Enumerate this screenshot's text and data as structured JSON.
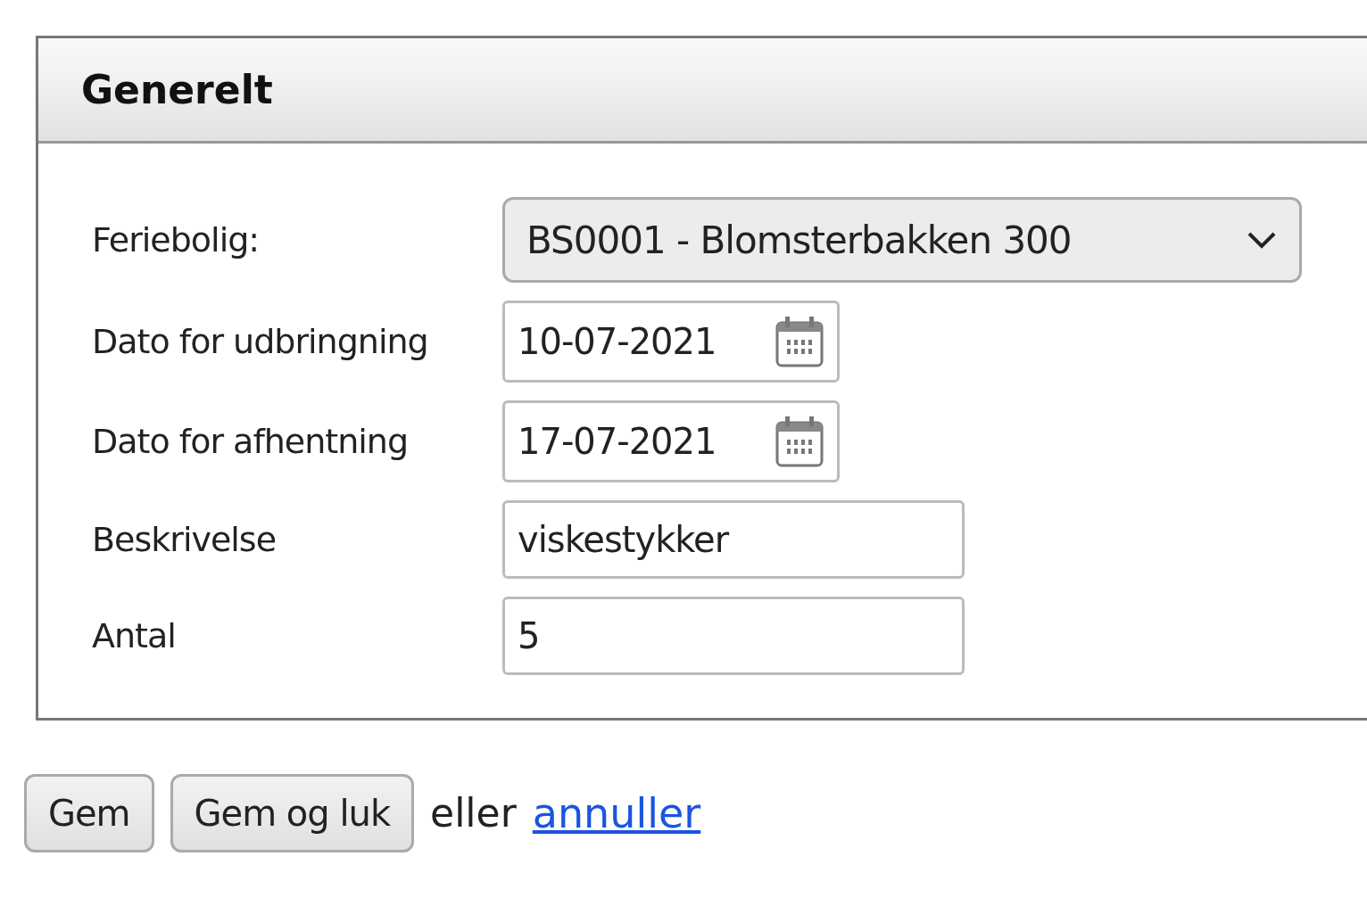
{
  "panel": {
    "title": "Generelt"
  },
  "fields": [
    {
      "kind": "select",
      "label": "Feriebolig:",
      "value": "BS0001 - Blomsterbakken 300"
    },
    {
      "kind": "date",
      "label": "Dato for udbringning",
      "value": "10-07-2021"
    },
    {
      "kind": "date",
      "label": "Dato for afhentning",
      "value": "17-07-2021"
    },
    {
      "kind": "text",
      "label": "Beskrivelse",
      "value": "viskestykker"
    },
    {
      "kind": "text",
      "label": "Antal",
      "value": "5"
    }
  ],
  "actions": {
    "buttons": [
      "Gem",
      "Gem og luk"
    ],
    "separator": "eller",
    "link": "annuller"
  }
}
